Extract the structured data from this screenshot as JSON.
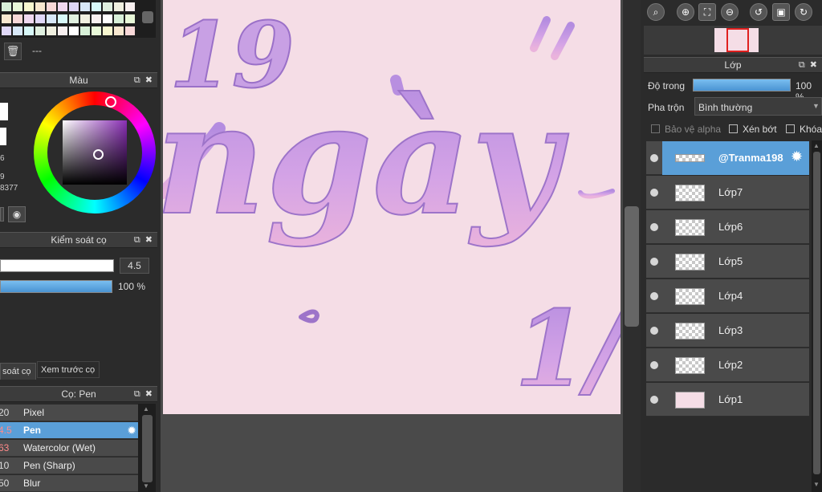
{
  "left": {
    "delete_text": "---",
    "color_panel": {
      "title": "Màu",
      "partial_values": [
        "6",
        "9",
        "8377"
      ]
    },
    "brush_control": {
      "title": "Kiểm soát cọ",
      "size_value": "4.5",
      "opacity_value": "100 %"
    },
    "tabs": {
      "control": "soát cọ",
      "preview": "Xem trước cọ"
    },
    "brush_list": {
      "title": "Cọ: Pen",
      "items": [
        {
          "size": "20",
          "name": "Pixel"
        },
        {
          "size": "4.5",
          "name": "Pen"
        },
        {
          "size": "63",
          "name": "Watercolor (Wet)"
        },
        {
          "size": "10",
          "name": "Pen (Sharp)"
        },
        {
          "size": "50",
          "name": "Blur"
        }
      ]
    }
  },
  "canvas": {
    "lettering": {
      "number_top": "19",
      "word": "ngày",
      "number_bottom": "1/",
      "quote": "“"
    },
    "background_color": "#f5dde6",
    "letter_color": "#c49be0"
  },
  "right": {
    "layer_panel": {
      "title": "Lớp",
      "opacity_label": "Độ trong",
      "opacity_value": "100 %",
      "blend_label": "Pha trộn",
      "blend_value": "Bình thường",
      "protect_alpha": "Bảo vệ alpha",
      "clipping": "Xén bớt",
      "lock": "Khóa"
    },
    "layers": [
      {
        "name": "@Tranma198",
        "selected": true
      },
      {
        "name": "Lớp7"
      },
      {
        "name": "Lớp6"
      },
      {
        "name": "Lớp5"
      },
      {
        "name": "Lớp4"
      },
      {
        "name": "Lớp3"
      },
      {
        "name": "Lớp2"
      },
      {
        "name": "Lớp1"
      }
    ]
  },
  "colors": {
    "accent": "#5a9fd8",
    "panel": "#3c3c3c",
    "selected_row": "#5a9fd8"
  }
}
